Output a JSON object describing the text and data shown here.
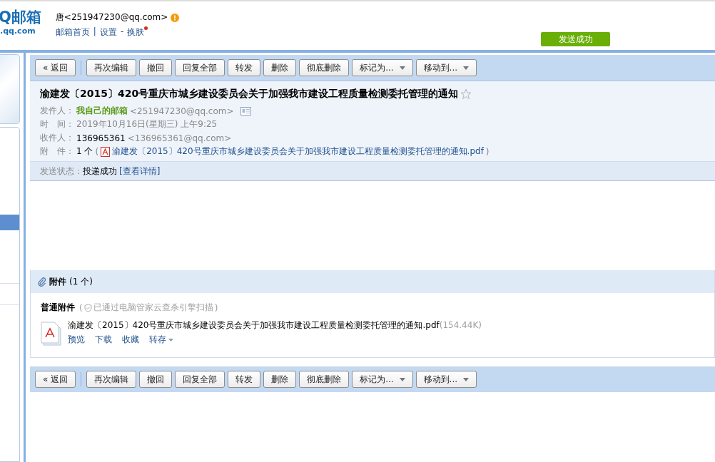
{
  "header": {
    "logo_main": "Q邮箱",
    "logo_sub": ".qq.com",
    "account": "唐<251947230@qq.com>",
    "links": [
      {
        "label": "邮箱首页"
      },
      {
        "sep": "|",
        "label": "设置"
      },
      {
        "sep": "-",
        "label": "换肤",
        "badge": true
      }
    ]
  },
  "toast": "发送成功",
  "toolbar_top": [
    {
      "label": "« 返回",
      "kind": "plain"
    },
    {
      "label": "再次编辑",
      "kind": "plain"
    },
    {
      "label": "撤回",
      "kind": "plain"
    },
    {
      "label": "回复全部",
      "kind": "plain"
    },
    {
      "label": "转发",
      "kind": "plain"
    },
    {
      "label": "删除",
      "kind": "plain"
    },
    {
      "label": "彻底删除",
      "kind": "plain"
    },
    {
      "label": "标记为...",
      "kind": "dropdown"
    },
    {
      "label": "移动到...",
      "kind": "dropdown"
    }
  ],
  "mail": {
    "subject": "渝建发〔2015〕420号重庆市城乡建设委员会关于加强我市建设工程质量检测委托管理的通知",
    "starred": false,
    "fields": [
      {
        "label": "发件人：",
        "kind": "sender",
        "name": "我自己的邮箱",
        "address": "<251947230@qq.com>"
      },
      {
        "label": "时　间：",
        "kind": "time",
        "value": "2019年10月16日(星期三) 上午9:25"
      },
      {
        "label": "收件人：",
        "kind": "recipient",
        "name": "136965361",
        "address": "<136965361@qq.com>"
      },
      {
        "label": "附　件：",
        "kind": "attachment",
        "count": "1 个",
        "open": "(",
        "file": "渝建发〔2015〕420号重庆市城乡建设委员会关于加强我市建设工程质量检测委托管理的通知.pdf",
        "close": ")"
      }
    ],
    "status_label": "发送状态：",
    "status": "投递成功",
    "status_link": "[查看详情]"
  },
  "attachments": {
    "title": "附件",
    "count": "(1 个)",
    "group": "普通附件",
    "scan": "已通过电脑管家云查杀引擎扫描",
    "open": "(",
    "close": ")",
    "files": [
      {
        "name": "渝建发〔2015〕420号重庆市城乡建设委员会关于加强我市建设工程质量检测委托管理的通知.pdf",
        "size": "(154.44K)",
        "actions": [
          {
            "label": "预览",
            "dropdown": false
          },
          {
            "label": "下载",
            "dropdown": false
          },
          {
            "label": "收藏",
            "dropdown": false
          },
          {
            "label": "转存",
            "dropdown": true
          }
        ]
      }
    ]
  },
  "toolbar_bottom": [
    {
      "label": "« 返回",
      "kind": "plain"
    },
    {
      "label": "再次编辑",
      "kind": "plain"
    },
    {
      "label": "撤回",
      "kind": "plain"
    },
    {
      "label": "回复全部",
      "kind": "plain"
    },
    {
      "label": "转发",
      "kind": "plain"
    },
    {
      "label": "删除",
      "kind": "plain"
    },
    {
      "label": "彻底删除",
      "kind": "plain"
    },
    {
      "label": "标记为...",
      "kind": "dropdown"
    },
    {
      "label": "移动到...",
      "kind": "dropdown"
    }
  ]
}
